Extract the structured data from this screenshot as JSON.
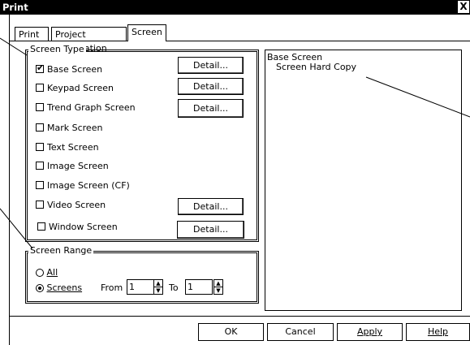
{
  "window": {
    "title": "Print",
    "close_glyph": "X"
  },
  "tabs": [
    {
      "label": "Print"
    },
    {
      "label": "Project Information"
    },
    {
      "label": "Screen"
    }
  ],
  "screen_type": {
    "legend": "Screen Type",
    "items": [
      {
        "label": "Base Screen",
        "checked": true,
        "detail": "Detail..."
      },
      {
        "label": "Keypad Screen",
        "checked": false,
        "detail": "Detail..."
      },
      {
        "label": "Trend Graph Screen",
        "checked": false,
        "detail": "Detail..."
      },
      {
        "label": "Mark Screen",
        "checked": false
      },
      {
        "label": "Text Screen",
        "checked": false
      },
      {
        "label": "Image Screen",
        "checked": false
      },
      {
        "label": "Image Screen (CF)",
        "checked": false
      },
      {
        "label": "Video Screen",
        "checked": false,
        "detail": "Detail..."
      },
      {
        "label": "Window Screen",
        "checked": false,
        "detail": "Detail..."
      }
    ]
  },
  "screen_range": {
    "legend": "Screen Range",
    "all_label": "All",
    "screens_label": "Screens",
    "from_label": "From",
    "to_label": "To",
    "from_value": "1",
    "to_value": "1",
    "selected": "Screens"
  },
  "preview": {
    "lines": [
      "Base Screen",
      "Screen Hard Copy"
    ]
  },
  "footer": {
    "ok": "OK",
    "cancel": "Cancel",
    "apply": "Apply",
    "help": "Help"
  }
}
